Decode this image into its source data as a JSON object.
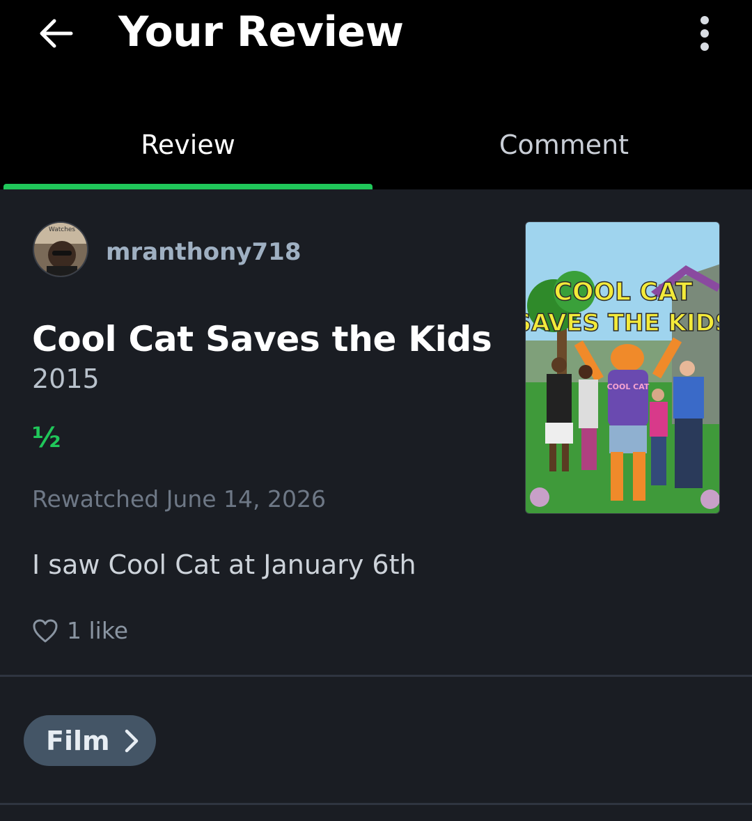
{
  "header": {
    "title": "Your Review",
    "back_icon": "arrow-left-icon",
    "more_icon": "more-vertical-icon"
  },
  "tabs": [
    {
      "label": "Review",
      "active": true
    },
    {
      "label": "Comment",
      "active": false
    }
  ],
  "review": {
    "username": "mranthony718",
    "avatar_badge": "Watches",
    "film_title": "Cool Cat Saves the Kids",
    "year": "2015",
    "rating": "½",
    "watched": "Rewatched June 14, 2026",
    "text": "I saw Cool Cat at January 6th",
    "likes": "1 like"
  },
  "poster": {
    "line1": "COOL CAT",
    "line2": "SAVES THE KIDS",
    "shirt": "COOL CAT"
  },
  "chip": {
    "label": "Film"
  },
  "colors": {
    "accent": "#20c75a",
    "background": "#1a1d23",
    "header": "#000000",
    "chip": "#445566"
  }
}
